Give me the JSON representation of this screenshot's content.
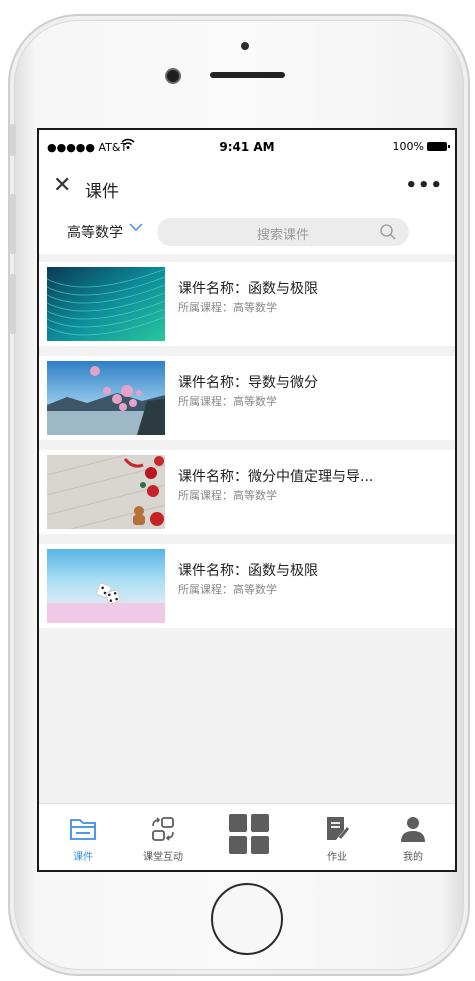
{
  "status": {
    "carrier": "●●●●● AT&T",
    "time": "9:41 AM",
    "battery": "100%"
  },
  "nav": {
    "close_icon": "close-icon",
    "title": "课件",
    "more": "•••"
  },
  "filter": {
    "subject": "高等数学",
    "search_placeholder": "搜索课件"
  },
  "courses": [
    {
      "title": "课件名称：函数与极限",
      "subtitle": "所属课程：高等数学",
      "thumb": "teal-wave-image"
    },
    {
      "title": "课件名称：导数与微分",
      "subtitle": "所属课程：高等数学",
      "thumb": "lake-balloons-image"
    },
    {
      "title": "课件名称：微分中值定理与导...",
      "subtitle": "所属课程：高等数学",
      "thumb": "christmas-cookies-image"
    },
    {
      "title": "课件名称：函数与极限",
      "subtitle": "所属课程：高等数学",
      "thumb": "dice-image"
    }
  ],
  "tabs": [
    {
      "label": "课件",
      "icon": "folder-icon",
      "active": true
    },
    {
      "label": "课堂互动",
      "icon": "interaction-icon",
      "active": false
    },
    {
      "label": "",
      "icon": "grid-icon",
      "active": false
    },
    {
      "label": "作业",
      "icon": "homework-icon",
      "active": false
    },
    {
      "label": "我的",
      "icon": "user-icon",
      "active": false
    }
  ],
  "colors": {
    "accent": "#3a8ee6",
    "icon_gray": "#5d5d5d"
  }
}
